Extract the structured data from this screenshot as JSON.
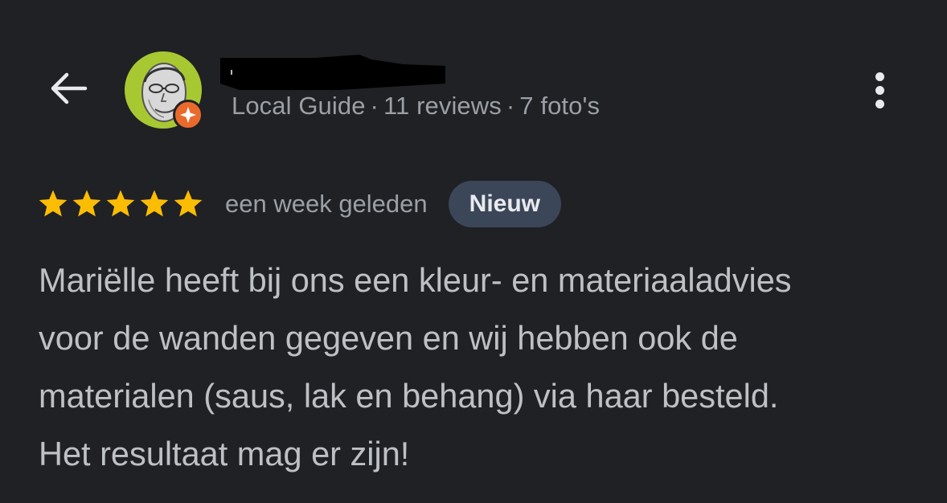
{
  "header": {
    "back_icon": "arrow-left-icon",
    "more_icon": "more-vert-icon",
    "reviewer": {
      "avatar_icon": "avatar-icon",
      "badge_icon": "local-guide-star-icon",
      "name_redacted": true,
      "level": "Local Guide",
      "separator": "·",
      "reviews": "11 reviews",
      "photos": "7 foto's"
    }
  },
  "review": {
    "rating": 5,
    "max_rating": 5,
    "date": "een week geleden",
    "badge": "Nieuw",
    "text": "Mariëlle heeft bij ons een kleur- en materiaaladvies\nvoor de wanden gegeven en wij hebben ook de\nmaterialen (saus, lak en behang) via haar besteld.\nHet resultaat mag er zijn!"
  },
  "colors": {
    "background": "#202124",
    "star": "#fbbc04",
    "badge_background": "#3c4659",
    "guide_badge": "#ea6a2e",
    "avatar_background": "#a8c832"
  }
}
